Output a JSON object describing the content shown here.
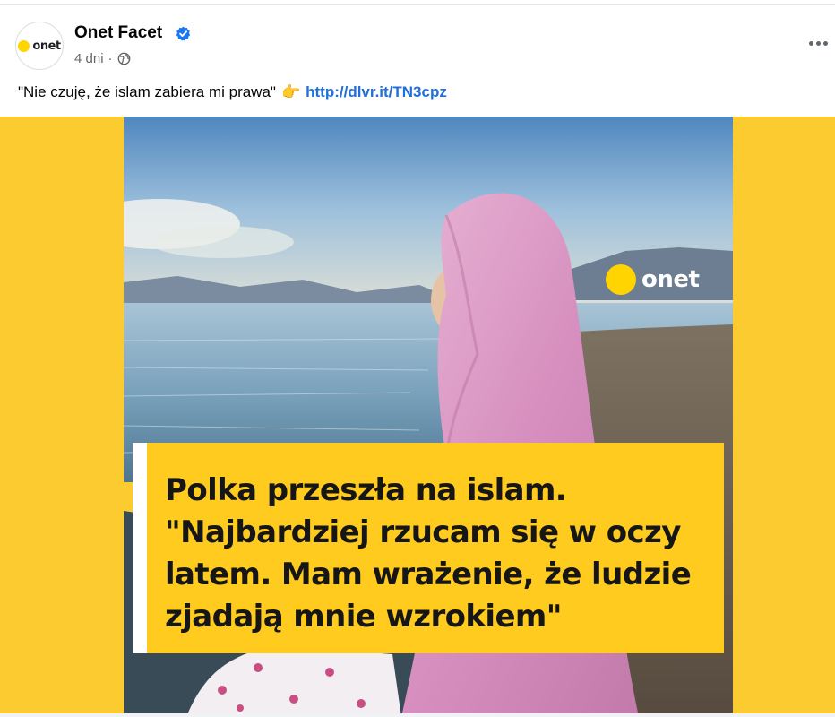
{
  "post": {
    "page_name": "Onet Facet",
    "avatar_text": "onet",
    "time": "4 dni",
    "separator": "·",
    "caption_text": "\"Nie czuję, że islam zabiera mi prawa\"",
    "caption_emoji": "👉",
    "caption_link": "http://dlvr.it/TN3cpz"
  },
  "image": {
    "brand_text": "onet",
    "headline_lines": [
      "Polka przeszła na islam.",
      "\"Najbardziej rzucam się w oczy",
      "latem. Mam wrażenie, że ludzie",
      "zjadają mnie wzrokiem\""
    ]
  },
  "colors": {
    "accent_yellow": "#FCCB2F",
    "link_blue": "#216fdb",
    "verified_blue": "#1877F2"
  },
  "icons": {
    "verified": "verified-badge-icon",
    "audience": "globe-icon",
    "menu": "more-options-icon"
  }
}
